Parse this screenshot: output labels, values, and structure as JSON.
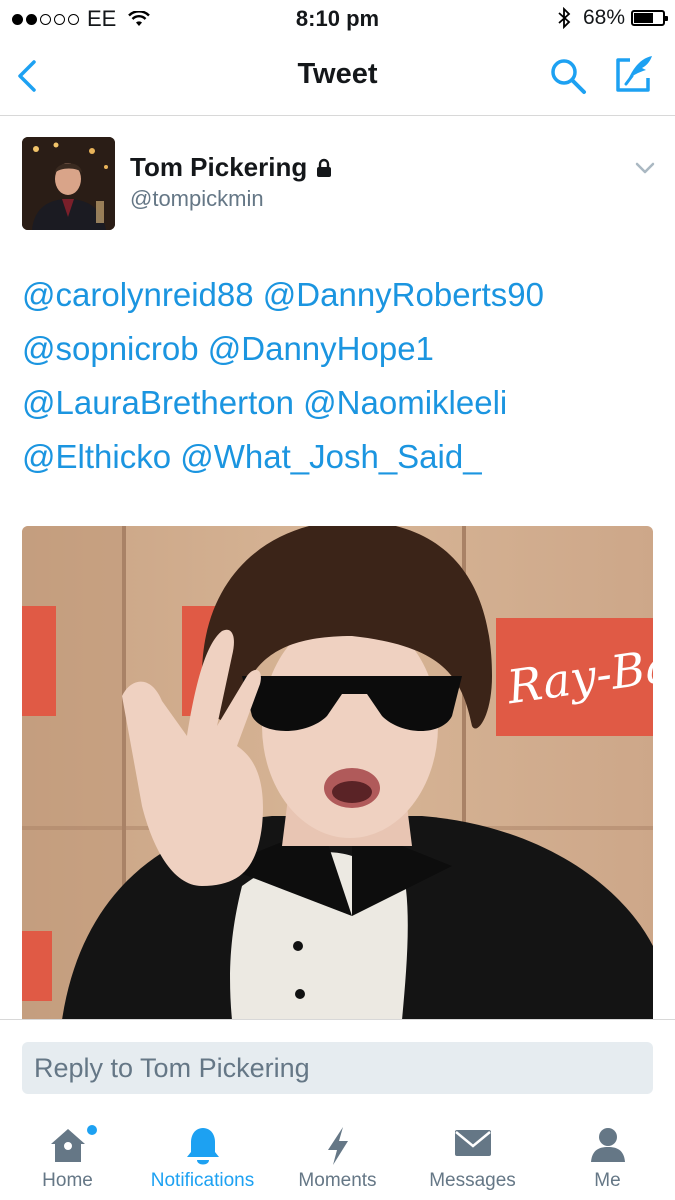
{
  "status_bar": {
    "carrier": "EE",
    "time": "8:10 pm",
    "battery_percent": "68%",
    "battery_level": 0.68,
    "signal_full_dots": 2,
    "signal_total_dots": 5
  },
  "nav": {
    "title": "Tweet",
    "back_icon": "chevron-left-icon",
    "search_icon": "search-icon",
    "compose_icon": "compose-tweet-icon"
  },
  "tweet": {
    "author_name": "Tom Pickering",
    "author_handle": "@tompickmin",
    "protected_icon": "lock-icon",
    "mention_lines": [
      [
        "@carolynreid88",
        "@DannyRoberts90"
      ],
      [
        "@sopnicrob",
        "@DannyHope1"
      ],
      [
        "@LauraBretherton",
        "@Naomikleeli"
      ],
      [
        "@Elthicko",
        "@What_Josh_Said_"
      ]
    ],
    "media_brand_text": "Ray-Ban"
  },
  "reply": {
    "placeholder": "Reply to Tom Pickering"
  },
  "tabs": [
    {
      "label": "Home",
      "icon": "home-icon"
    },
    {
      "label": "Notifications",
      "icon": "bell-icon"
    },
    {
      "label": "Moments",
      "icon": "lightning-icon"
    },
    {
      "label": "Messages",
      "icon": "envelope-icon"
    },
    {
      "label": "Me",
      "icon": "person-icon"
    }
  ],
  "colors": {
    "accent": "#1da1f2",
    "secondary_text": "#657786",
    "reply_bg": "#e6ecf0"
  }
}
